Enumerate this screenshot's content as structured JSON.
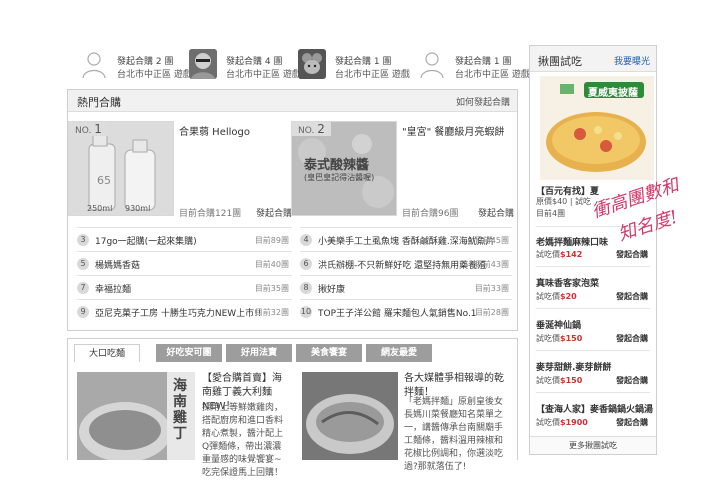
{
  "top_users": [
    {
      "line1": "發起合購 2 團",
      "line2": "台北市中正區 遊戲",
      "avatar": "default-user-icon"
    },
    {
      "line1": "發起合購 4 團",
      "line2": "台北市中正區 遊戲",
      "avatar": "photo"
    },
    {
      "line1": "發起合購 1 團",
      "line2": "台北市中正區 遊戲",
      "avatar": "photo-mouse"
    },
    {
      "line1": "發起合購 1 團",
      "line2": "台北市中正區 遊戲",
      "avatar": "default-user-icon"
    }
  ],
  "hot": {
    "title": "熱門合購",
    "how_link": "如何發起合購",
    "featured": [
      {
        "no_prefix": "NO.",
        "no": "1",
        "title": "合果蒻 Hellogo",
        "meta": "目前合購121團",
        "btn": "發起合購",
        "img_label": "65",
        "vol1": "250ml",
        "vol2": "930ml"
      },
      {
        "no_prefix": "NO.",
        "no": "2",
        "title": "\"皇宮\" 餐廳級月亮蝦餅",
        "meta": "目前合購96團",
        "btn": "發起合購",
        "img_label": "泰式酸辣醬",
        "img_sub": "(皇巴皇記得沾醬喔)"
      }
    ],
    "list_left": [
      {
        "n": "3",
        "text": "17go一起購(一起來集購)",
        "count": "目前89團"
      },
      {
        "n": "5",
        "text": "楊媽媽香菇",
        "count": "目前40團"
      },
      {
        "n": "7",
        "text": "幸福拉麵",
        "count": "目前35團"
      },
      {
        "n": "9",
        "text": "亞尼克菓子工房 十勝生巧克力NEW上市!!",
        "count": "目前32團"
      }
    ],
    "list_right": [
      {
        "n": "4",
        "text": "小美樂手工土虱魚塊 香酥鹹酥雞.深海魷魚片",
        "count": "目前45團"
      },
      {
        "n": "6",
        "text": "洪氏辦棚-不只新鮮好吃 還堅持無用藥養殖",
        "count": "目前43團"
      },
      {
        "n": "8",
        "text": "揪好康",
        "count": "目前33團"
      },
      {
        "n": "10",
        "text": "TOP王子洋公館 羅宋麵包人氣銷售No.1",
        "count": "目前28團"
      }
    ]
  },
  "tabs": [
    "大口吃麵",
    "好吃安可團",
    "好用法寶",
    "美食饗宴",
    "網友最愛"
  ],
  "articles": [
    {
      "title": "【愛合購首賣】海南雞丁義大利麵NEW！",
      "body": "採用上等鮮嫩雞肉，搭配廚房和進口香料精心煮製，醬汁配上Q彈麵條，帶出濃濃重量感的味覺饗宴~吃完保證馬上回購！",
      "img_text": "海南雞丁"
    },
    {
      "title": "各大媒體爭相報導的乾拌麵！",
      "body": "「老媽拌麵」原創皇後女長媽川菜餐廳知名菜單之一，講醬傳承台南關廟手工麵條，醬料溫用辣椒和花椒比例調和，你選淡吃過?那就落伍了!"
    }
  ],
  "right_panel": {
    "title": "揪團試吃",
    "more_link": "我要曝光",
    "hero": {
      "img_text": "夏威夷披薩",
      "title": "【百元有找】夏",
      "price_line": "原價$40",
      "price_suffix": "試吃",
      "count_line": "目前4團"
    },
    "items": [
      {
        "title": "老媽拌麵麻辣口味",
        "price_label": "試吃價",
        "price": "$142",
        "btn": "發起合購"
      },
      {
        "title": "真味香客家泡菜",
        "price_label": "試吃價",
        "price": "$20",
        "btn": "發起合購"
      },
      {
        "title": "垂涎神仙鍋",
        "price_label": "試吃價",
        "price": "$150",
        "btn": "發起合購"
      },
      {
        "title": "麥芽甜餅.麥芽餅餅",
        "price_label": "試吃價",
        "price": "$150",
        "btn": "發起合購"
      },
      {
        "title": "【查海人家】麥香鍋鍋火鍋湯",
        "price_label": "試吃價",
        "price": "$1900",
        "btn": "發起合購"
      }
    ],
    "footer": "更多揪團試吃"
  },
  "handwriting": [
    "衝高團數和",
    "知名度!"
  ],
  "colors": {
    "price_red": "#d03030",
    "link_blue": "#2060b0",
    "handwriting_pink": "#d23a6a"
  }
}
